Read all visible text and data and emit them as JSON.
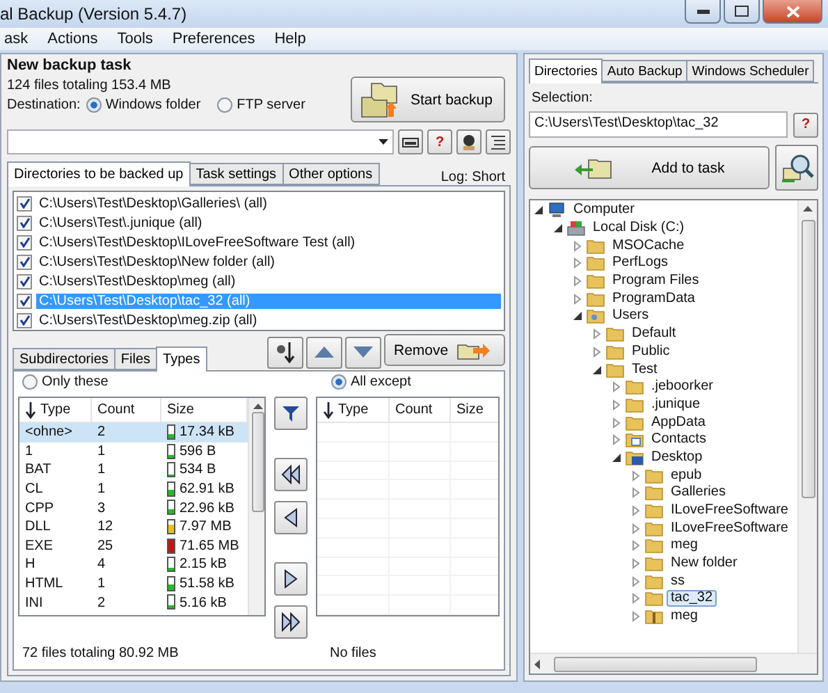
{
  "window": {
    "title": "al Backup (Version 5.4.7)"
  },
  "menu": [
    "ask",
    "Actions",
    "Tools",
    "Preferences",
    "Help"
  ],
  "task": {
    "title": "New backup task",
    "summary": "124 files totaling 153.4 MB",
    "destination_label": "Destination:",
    "start_button": "Start backup",
    "destinations": [
      {
        "label": "Windows folder",
        "selected": true
      },
      {
        "label": "FTP server",
        "selected": false
      }
    ]
  },
  "help_label": "?",
  "tabs": [
    {
      "label": "Directories to be backed up",
      "selected": true
    },
    {
      "label": "Task settings",
      "selected": false
    },
    {
      "label": "Other options",
      "selected": false
    }
  ],
  "log": "Log: Short",
  "directories": [
    {
      "path": "C:\\Users\\Test\\Desktop\\Galleries\\ (all)",
      "checked": true,
      "selected": false
    },
    {
      "path": "C:\\Users\\Test\\.junique (all)",
      "checked": true,
      "selected": false
    },
    {
      "path": "C:\\Users\\Test\\Desktop\\ILoveFreeSoftware Test (all)",
      "checked": true,
      "selected": false
    },
    {
      "path": "C:\\Users\\Test\\Desktop\\New folder (all)",
      "checked": true,
      "selected": false
    },
    {
      "path": "C:\\Users\\Test\\Desktop\\meg (all)",
      "checked": true,
      "selected": false
    },
    {
      "path": "C:\\Users\\Test\\Desktop\\tac_32 (all)",
      "checked": true,
      "selected": true
    },
    {
      "path": "C:\\Users\\Test\\Desktop\\meg.zip (all)",
      "checked": true,
      "selected": false
    }
  ],
  "remove_button": "Remove",
  "subtabs": [
    {
      "label": "Subdirectories",
      "selected": false
    },
    {
      "label": "Files",
      "selected": false
    },
    {
      "label": "Types",
      "selected": true
    }
  ],
  "filter_modes": [
    {
      "label": "Only these",
      "selected": false
    },
    {
      "label": "All except",
      "selected": true
    }
  ],
  "types_table": {
    "columns": [
      "Type",
      "Count",
      "Size"
    ],
    "summary": "72 files totaling 80.92 MB",
    "rows": [
      {
        "type": "<ohne>",
        "count": "2",
        "size": "17.34 kB",
        "level": 0.3,
        "selected": true
      },
      {
        "type": "1",
        "count": "1",
        "size": "596 B",
        "level": 0.15,
        "selected": false
      },
      {
        "type": "BAT",
        "count": "1",
        "size": "534 B",
        "level": 0.15,
        "selected": false
      },
      {
        "type": "CL",
        "count": "1",
        "size": "62.91 kB",
        "level": 0.45,
        "selected": false
      },
      {
        "type": "CPP",
        "count": "3",
        "size": "22.96 kB",
        "level": 0.35,
        "selected": false
      },
      {
        "type": "DLL",
        "count": "12",
        "size": "7.97 MB",
        "level": 0.7,
        "selected": false
      },
      {
        "type": "EXE",
        "count": "25",
        "size": "71.65 MB",
        "level": 0.95,
        "selected": false
      },
      {
        "type": "H",
        "count": "4",
        "size": "2.15 kB",
        "level": 0.2,
        "selected": false
      },
      {
        "type": "HTML",
        "count": "1",
        "size": "51.58 kB",
        "level": 0.45,
        "selected": false
      },
      {
        "type": "INI",
        "count": "2",
        "size": "5.16 kB",
        "level": 0.25,
        "selected": false
      }
    ]
  },
  "excluded_table": {
    "columns": [
      "Type",
      "Count",
      "Size"
    ],
    "summary": "No files"
  },
  "right_tabs": [
    {
      "label": "Directories",
      "selected": true
    },
    {
      "label": "Auto Backup",
      "selected": false
    },
    {
      "label": "Windows Scheduler",
      "selected": false
    }
  ],
  "selection": {
    "label": "Selection:",
    "value": "C:\\Users\\Test\\Desktop\\tac_32"
  },
  "add_button": "Add to task",
  "tree": [
    {
      "label": "Computer",
      "kind": "computer",
      "expanded": true,
      "selected": false,
      "children": [
        {
          "label": "Local Disk (C:)",
          "kind": "drive",
          "expanded": true,
          "selected": false,
          "children": [
            {
              "label": "MSOCache",
              "kind": "folder",
              "expanded": false,
              "selected": false
            },
            {
              "label": "PerfLogs",
              "kind": "folder",
              "expanded": false,
              "selected": false
            },
            {
              "label": "Program Files",
              "kind": "folder",
              "expanded": false,
              "selected": false
            },
            {
              "label": "ProgramData",
              "kind": "folder",
              "expanded": false,
              "selected": false
            },
            {
              "label": "Users",
              "kind": "users",
              "expanded": true,
              "selected": false,
              "children": [
                {
                  "label": "Default",
                  "kind": "folder",
                  "expanded": false,
                  "selected": false
                },
                {
                  "label": "Public",
                  "kind": "folder",
                  "expanded": false,
                  "selected": false
                },
                {
                  "label": "Test",
                  "kind": "folder",
                  "expanded": true,
                  "selected": false,
                  "children": [
                    {
                      "label": ".jeboorker",
                      "kind": "folder",
                      "expanded": false,
                      "selected": false
                    },
                    {
                      "label": ".junique",
                      "kind": "folder",
                      "expanded": false,
                      "selected": false
                    },
                    {
                      "label": "AppData",
                      "kind": "folder",
                      "expanded": false,
                      "selected": false
                    },
                    {
                      "label": "Contacts",
                      "kind": "contacts",
                      "expanded": false,
                      "selected": false
                    },
                    {
                      "label": "Desktop",
                      "kind": "desktop",
                      "expanded": true,
                      "selected": false,
                      "children": [
                        {
                          "label": "epub",
                          "kind": "folder",
                          "expanded": false,
                          "selected": false
                        },
                        {
                          "label": "Galleries",
                          "kind": "folder",
                          "expanded": false,
                          "selected": false
                        },
                        {
                          "label": "ILoveFreeSoftware",
                          "kind": "folder",
                          "expanded": false,
                          "selected": false
                        },
                        {
                          "label": "ILoveFreeSoftware",
                          "kind": "folder",
                          "expanded": false,
                          "selected": false
                        },
                        {
                          "label": "meg",
                          "kind": "folder",
                          "expanded": false,
                          "selected": false
                        },
                        {
                          "label": "New folder",
                          "kind": "folder",
                          "expanded": false,
                          "selected": false
                        },
                        {
                          "label": "ss",
                          "kind": "folder",
                          "expanded": false,
                          "selected": false
                        },
                        {
                          "label": "tac_32",
                          "kind": "folder",
                          "expanded": false,
                          "selected": true
                        },
                        {
                          "label": "meg",
                          "kind": "zip",
                          "expanded": false,
                          "selected": false
                        }
                      ]
                    }
                  ]
                }
              ]
            }
          ]
        }
      ]
    }
  ]
}
